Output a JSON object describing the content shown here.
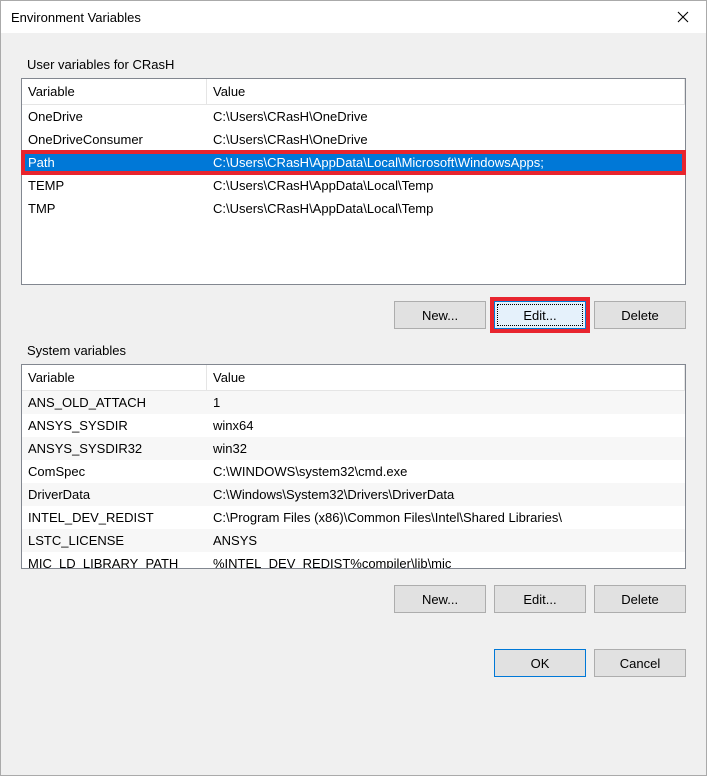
{
  "window": {
    "title": "Environment Variables"
  },
  "user_section": {
    "label": "User variables for CRasH",
    "columns": {
      "variable": "Variable",
      "value": "Value"
    },
    "new_btn": "New...",
    "edit_btn": "Edit...",
    "delete_btn": "Delete",
    "rows": [
      {
        "var": "OneDrive",
        "val": "C:\\Users\\CRasH\\OneDrive"
      },
      {
        "var": "OneDriveConsumer",
        "val": "C:\\Users\\CRasH\\OneDrive"
      },
      {
        "var": "Path",
        "val": "C:\\Users\\CRasH\\AppData\\Local\\Microsoft\\WindowsApps;"
      },
      {
        "var": "TEMP",
        "val": "C:\\Users\\CRasH\\AppData\\Local\\Temp"
      },
      {
        "var": "TMP",
        "val": "C:\\Users\\CRasH\\AppData\\Local\\Temp"
      }
    ]
  },
  "system_section": {
    "label": "System variables",
    "columns": {
      "variable": "Variable",
      "value": "Value"
    },
    "new_btn": "New...",
    "edit_btn": "Edit...",
    "delete_btn": "Delete",
    "rows": [
      {
        "var": "ANS_OLD_ATTACH",
        "val": "1"
      },
      {
        "var": "ANSYS_SYSDIR",
        "val": "winx64"
      },
      {
        "var": "ANSYS_SYSDIR32",
        "val": "win32"
      },
      {
        "var": "ComSpec",
        "val": "C:\\WINDOWS\\system32\\cmd.exe"
      },
      {
        "var": "DriverData",
        "val": "C:\\Windows\\System32\\Drivers\\DriverData"
      },
      {
        "var": "INTEL_DEV_REDIST",
        "val": "C:\\Program Files (x86)\\Common Files\\Intel\\Shared Libraries\\"
      },
      {
        "var": "LSTC_LICENSE",
        "val": "ANSYS"
      },
      {
        "var": "MIC_LD_LIBRARY_PATH",
        "val": "%INTEL_DEV_REDIST%compiler\\lib\\mic"
      }
    ]
  },
  "footer": {
    "ok": "OK",
    "cancel": "Cancel"
  }
}
